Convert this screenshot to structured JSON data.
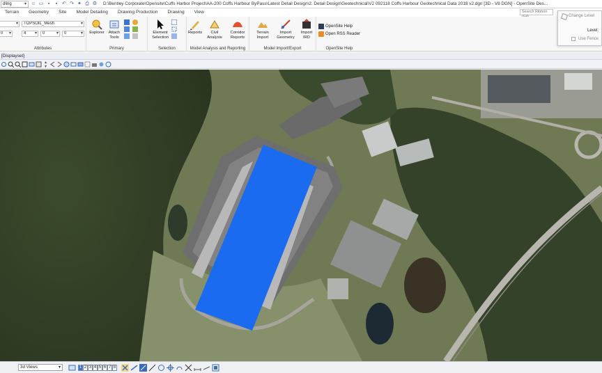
{
  "titlebar": {
    "workspace": "dling",
    "path": "D:\\Bentley Corporate\\Opensite\\Cuffs Harbor Project\\AA-200 Coffs Harbour ByPass\\Latest Detail Design\\2. Detail Design\\Geotechnical\\V2 092118 Coffs Harbour Geotechnical Data 2018 v2.dgn [3D - V8 DGN] - OpenSite Des..."
  },
  "tabs": [
    "Terrain",
    "Geometry",
    "Site",
    "Model Detailing",
    "Drawing Production",
    "Drawing",
    "View"
  ],
  "search": {
    "placeholder": "Search Ribbon (F4)"
  },
  "attributes": {
    "label": "Attributes",
    "level_value": "TOPSOIL_Mesh",
    "color_value": "0",
    "weight_value": "4",
    "style_value": "0",
    "transparency_value": "0",
    "priority_value": "0"
  },
  "primary": {
    "label": "Primary",
    "explorer": "Explorer",
    "attach_tools": "Attach\nTools"
  },
  "selection": {
    "label": "Selection",
    "element_selection": "Element\nSelection"
  },
  "analysis": {
    "label": "Model Analysis and Reporting",
    "reports": "Reports",
    "civil_analysis": "Civil\nAnalysis",
    "corridor_reports": "Corridor\nReports"
  },
  "import_export": {
    "label": "Model Import/Export",
    "terrain_import": "Terrain\nImport",
    "import_geometry": "Import\nGeometry",
    "import_ird": "Import\nIRD"
  },
  "help": {
    "label": "OpenSite Help",
    "opensite_help": "OpenSite Help",
    "open_rss": "Open RSS Reader"
  },
  "dialog": {
    "title": "Change Level",
    "level_label": "Level:",
    "use_fence": "Use Fence"
  },
  "view": {
    "header": "[Displayset]"
  },
  "bottombar": {
    "view_select": "3d Views",
    "view_numbers": [
      "1",
      "2",
      "3",
      "4",
      "5",
      "6",
      "7",
      "8"
    ],
    "active_view": "1"
  },
  "colors": {
    "accent_blue": "#1a6bf0",
    "ribbon_bg": "#f7f7f7",
    "pad_gray": "#7a7a7a"
  }
}
